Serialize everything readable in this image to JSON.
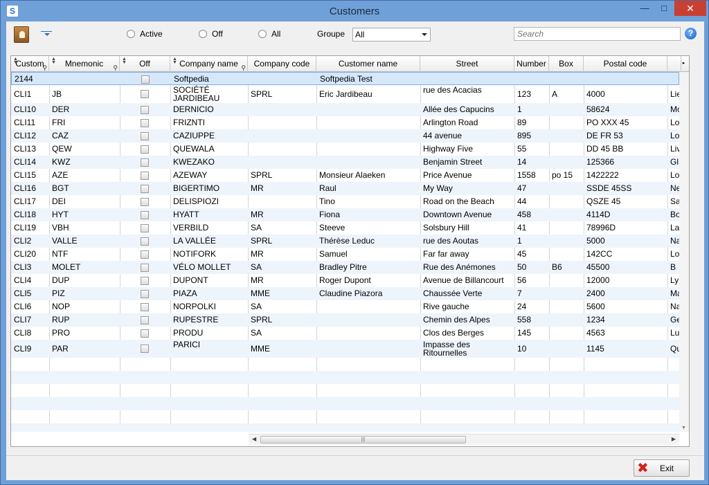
{
  "window": {
    "title": "Customers",
    "app_icon": "S",
    "minimize": "—",
    "maximize": "□",
    "close": "✕"
  },
  "toolbar": {
    "filters": [
      {
        "label": "Active"
      },
      {
        "label": "Off"
      },
      {
        "label": "All"
      }
    ],
    "groupe_label": "Groupe",
    "groupe_value": "All",
    "search_placeholder": "Search",
    "help_glyph": "?"
  },
  "grid": {
    "columns": [
      "Customer",
      "Mnemonic",
      "Off",
      "Company name",
      "Company code",
      "Customer name",
      "Street",
      "Number",
      "Box",
      "Postal code"
    ],
    "first_column_display": "Custom",
    "selected_row": [
      "2144",
      "",
      "",
      "Softpedia",
      "",
      "Softpedia Test",
      "",
      "",
      "",
      "",
      ""
    ],
    "rows": [
      [
        "CLI1",
        "JB",
        "",
        "SOCIÉTÉ JARDIBEAU",
        "SPRL",
        "Eric Jardibeau",
        "rue des Acacias",
        "123",
        "A",
        "4000",
        "Lie"
      ],
      [
        "CLI10",
        "DER",
        "",
        "DERNICIO",
        "",
        "",
        "Allée des Capucins",
        "1",
        "",
        "58624",
        "Mo"
      ],
      [
        "CLI11",
        "FRI",
        "",
        "FRIZNTI",
        "",
        "",
        "Arlington Road",
        "89",
        "",
        "PO XXX 45",
        "Lo"
      ],
      [
        "CLI12",
        "CAZ",
        "",
        "CAZIUPPE",
        "",
        "",
        "44 avenue",
        "895",
        "",
        "DE FR 53",
        "Lo"
      ],
      [
        "CLI13",
        "QEW",
        "",
        "QUEWALA",
        "",
        "",
        "Highway Five",
        "55",
        "",
        "DD 45 BB",
        "Liv"
      ],
      [
        "CLI14",
        "KWZ",
        "",
        "KWEZAKO",
        "",
        "",
        "Benjamin Street",
        "14",
        "",
        "125366",
        "Gl"
      ],
      [
        "CLI15",
        "AZE",
        "",
        "AZEWAY",
        "SPRL",
        "Monsieur Alaeken",
        "Price Avenue",
        "1558",
        "po 15",
        "1422222",
        "Lo"
      ],
      [
        "CLI16",
        "BGT",
        "",
        "BIGERTIMO",
        "MR",
        "Raul",
        "My Way",
        "47",
        "",
        "SSDE 45SS",
        "Ne"
      ],
      [
        "CLI17",
        "DEI",
        "",
        "DELISPIOZI",
        "",
        "Tino",
        "Road on the Beach",
        "44",
        "",
        "QSZE 45",
        "Sa"
      ],
      [
        "CLI18",
        "HYT",
        "",
        "HYATT",
        "MR",
        "Fiona",
        "Downtown Avenue",
        "458",
        "",
        "4114D",
        "Bo"
      ],
      [
        "CLI19",
        "VBH",
        "",
        "VERBILD",
        "SA",
        "Steeve",
        "Solsbury Hill",
        "41",
        "",
        "78996D",
        "La"
      ],
      [
        "CLI2",
        "VALLE",
        "",
        "LA VALLÉE",
        "SPRL",
        "Thérèse Leduc",
        "rue des Aoutas",
        "1",
        "",
        "5000",
        "Na"
      ],
      [
        "CLI20",
        "NTF",
        "",
        "NOTIFORK",
        "MR",
        "Samuel",
        "Far far away",
        "45",
        "",
        "142CC",
        "Lo"
      ],
      [
        "CLI3",
        "MOLET",
        "",
        "VÉLO MOLLET",
        "SA",
        "Bradley Pitre",
        "Rue des Anémones",
        "50",
        "B6",
        "45500",
        "B"
      ],
      [
        "CLI4",
        "DUP",
        "",
        "DUPONT",
        "MR",
        "Roger Dupont",
        "Avenue de Billancourt",
        "56",
        "",
        "12000",
        "Ly"
      ],
      [
        "CLI5",
        "PIZ",
        "",
        "PIAZA",
        "MME",
        "Claudine Piazora",
        "Chaussée Verte",
        "7",
        "",
        "2400",
        "Ma"
      ],
      [
        "CLI6",
        "NOP",
        "",
        "NORPOLKI",
        "SA",
        "",
        "Rive gauche",
        "24",
        "",
        "5600",
        "Na"
      ],
      [
        "CLI7",
        "RUP",
        "",
        "RUPESTRE",
        "SPRL",
        "",
        "Chemin des Alpes",
        "558",
        "",
        "1234",
        "Ge"
      ],
      [
        "CLI8",
        "PRO",
        "",
        "PRODU",
        "SA",
        "",
        "Clos des Berges",
        "145",
        "",
        "4563",
        "Lu"
      ],
      [
        "CLI9",
        "PAR",
        "",
        "PARICI",
        "MME",
        "",
        "Impasse des Ritournelles",
        "10",
        "",
        "1145",
        "Qu"
      ]
    ],
    "scroll_right_glyph": "▸",
    "hscroll_grip": "|||"
  },
  "footer": {
    "exit_label": "Exit",
    "exit_glyph": "✖"
  },
  "colors": {
    "title_bar": "#6fa0d8",
    "selection": "#d6e7fa",
    "alt_row": "#eef4fb",
    "close": "#c84031"
  }
}
